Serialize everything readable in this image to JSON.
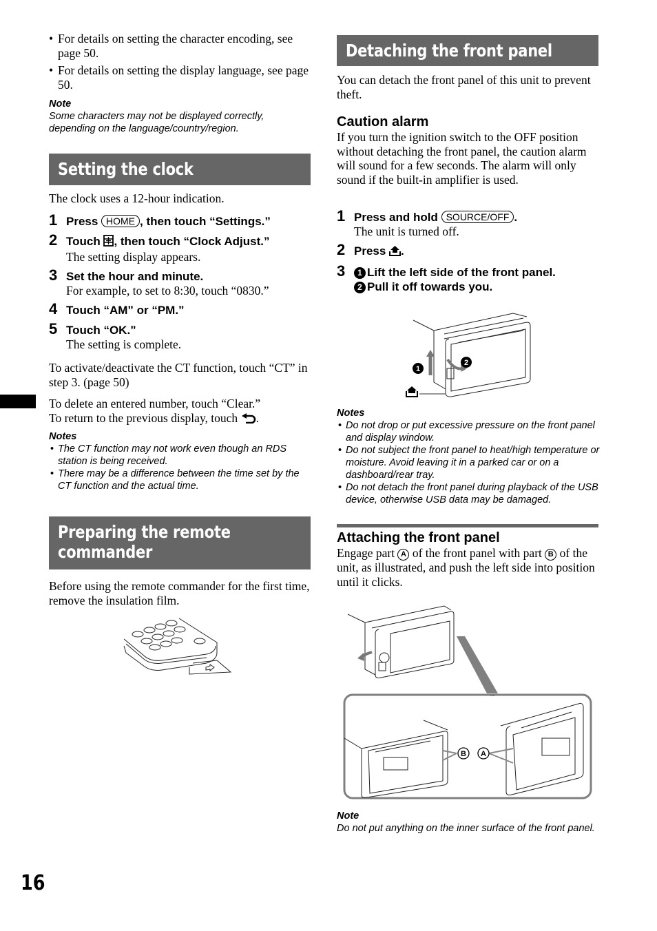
{
  "page_number": "16",
  "left_column": {
    "intro_bullets": [
      "For details on setting the character encoding, see page 50.",
      "For details on setting the display language, see page 50."
    ],
    "intro_note": {
      "title": "Note",
      "text": "Some characters may not be displayed correctly, depending on the language/country/region."
    },
    "clock_section": {
      "title": "Setting the clock",
      "intro": "The clock uses a 12-hour indication.",
      "steps": [
        {
          "num": "1",
          "pre": "Press ",
          "key": "HOME",
          "post": ", then touch “Settings.”",
          "desc": ""
        },
        {
          "num": "2",
          "pre": "Touch ",
          "icon": "settings-list-icon",
          "post": ", then touch “Clock Adjust.”",
          "desc": "The setting display appears."
        },
        {
          "num": "3",
          "title": "Set the hour and minute.",
          "desc": "For example, to set to 8:30, touch “0830.”"
        },
        {
          "num": "4",
          "title": "Touch “AM” or “PM.”",
          "desc": ""
        },
        {
          "num": "5",
          "title": "Touch “OK.”",
          "desc": "The setting is complete."
        }
      ],
      "ct_text": "To activate/deactivate the CT function, touch “CT” in step 3. (page 50)",
      "clear_text_1": "To delete an entered number, touch “Clear.”",
      "clear_text_2": "To return to the previous display, touch",
      "clear_text_2_end": ".",
      "notes": {
        "title": "Notes",
        "items": [
          "The CT function may not work even though an RDS station is being received.",
          "There may be a difference between the time set by the CT function and the actual time."
        ]
      }
    },
    "remote_section": {
      "title_line1": "Preparing the remote",
      "title_line2": "commander",
      "text": "Before using the remote commander for the first time, remove the insulation film."
    }
  },
  "right_column": {
    "detach_section": {
      "title": "Detaching the front panel",
      "intro": "You can detach the front panel of this unit to prevent theft.",
      "caution_title": "Caution alarm",
      "caution_text": "If you turn the ignition switch to the OFF position without detaching the front panel, the caution alarm will sound for a few seconds. The alarm will only sound if the built-in amplifier is used.",
      "steps": [
        {
          "num": "1",
          "pre": "Press and hold ",
          "key": "SOURCE/OFF",
          "post": ".",
          "desc": "The unit is turned off."
        },
        {
          "num": "2",
          "pre": "Press ",
          "icon": "release-icon",
          "post": "."
        },
        {
          "num": "3",
          "sub1_marker": "1",
          "sub1": "Lift the left side of the front panel.",
          "sub2_marker": "2",
          "sub2": "Pull it off towards you."
        }
      ],
      "figure_labels": {
        "step1": "1",
        "step2": "2"
      },
      "notes": {
        "title": "Notes",
        "items": [
          "Do not drop or put excessive pressure on the front panel and display window.",
          "Do not subject the front panel to heat/high temperature or moisture. Avoid leaving it in a parked car or on a dashboard/rear tray.",
          "Do not detach the front panel during playback of the USB device, otherwise USB data may be damaged."
        ]
      }
    },
    "attach_section": {
      "title": "Attaching the front panel",
      "text_pre": "Engage part ",
      "part_a": "A",
      "text_mid": " of the front panel with part ",
      "part_b": "B",
      "text_post": " of the unit, as illustrated, and push the left side into position until it clicks.",
      "figure_labels": {
        "a": "A",
        "b": "B"
      },
      "note": {
        "title": "Note",
        "text": "Do not put anything on the inner surface of the front panel."
      }
    }
  }
}
